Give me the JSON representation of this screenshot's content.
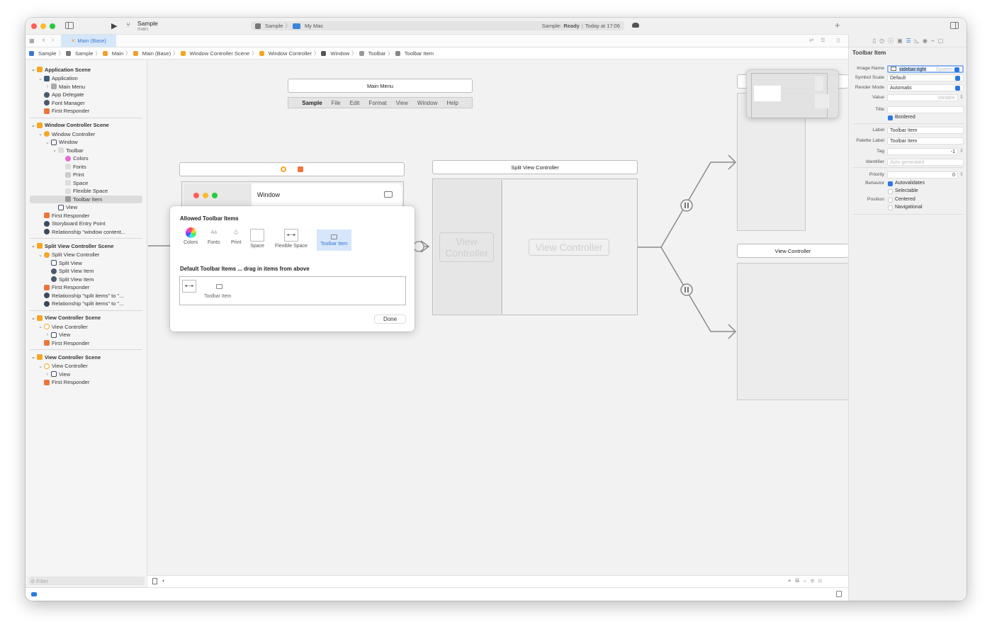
{
  "toolbar": {
    "scheme": "Sample",
    "branch": "main",
    "destination_project": "Sample",
    "destination": "My Mac",
    "status_prefix": "Sample: ",
    "status": "Ready",
    "status_time": "Today at 17:06",
    "add": "+"
  },
  "tab": {
    "label": "Main (Base)"
  },
  "breadcrumbs": [
    "Sample",
    "Sample",
    "Main",
    "Main (Base)",
    "Window Controller Scene",
    "Window Controller",
    "Window",
    "Toolbar",
    "Toolbar Item"
  ],
  "navigator": {
    "filter_placeholder": "Filter",
    "sections": [
      {
        "items": [
          {
            "label": "Application Scene",
            "level": 0,
            "header": true,
            "disc": "v",
            "icon": "scene-icon"
          },
          {
            "label": "Application",
            "level": 1,
            "disc": "v",
            "icon": "app-icon"
          },
          {
            "label": "Main Menu",
            "level": 2,
            "disc": ">",
            "icon": "menu-icon"
          },
          {
            "label": "App Delegate",
            "level": 1,
            "icon": "object-icon"
          },
          {
            "label": "Font Manager",
            "level": 1,
            "icon": "object-icon"
          },
          {
            "label": "First Responder",
            "level": 1,
            "icon": "first-responder-icon"
          }
        ]
      },
      {
        "items": [
          {
            "label": "Window Controller Scene",
            "level": 0,
            "header": true,
            "disc": "v",
            "icon": "scene-icon"
          },
          {
            "label": "Window Controller",
            "level": 1,
            "disc": "v",
            "icon": "window-controller-icon"
          },
          {
            "label": "Window",
            "level": 2,
            "disc": "v",
            "icon": "window-icon"
          },
          {
            "label": "Toolbar",
            "level": 3,
            "disc": "v",
            "icon": "toolbar-icon"
          },
          {
            "label": "Colors",
            "level": 4,
            "icon": "colors-icon"
          },
          {
            "label": "Fonts",
            "level": 4,
            "icon": "fonts-icon"
          },
          {
            "label": "Print",
            "level": 4,
            "icon": "print-icon"
          },
          {
            "label": "Space",
            "level": 4,
            "icon": "space-icon"
          },
          {
            "label": "Flexible Space",
            "level": 4,
            "icon": "flexible-space-icon"
          },
          {
            "label": "Toolbar Item",
            "level": 4,
            "icon": "gear-icon",
            "selected": true
          },
          {
            "label": "View",
            "level": 3,
            "icon": "view-icon"
          },
          {
            "label": "First Responder",
            "level": 1,
            "icon": "first-responder-icon"
          },
          {
            "label": "Storyboard Entry Point",
            "level": 1,
            "icon": "entry-point-icon"
          },
          {
            "label": "Relationship \"window content...",
            "level": 1,
            "icon": "relationship-icon"
          }
        ]
      },
      {
        "items": [
          {
            "label": "Split View Controller Scene",
            "level": 0,
            "header": true,
            "disc": "v",
            "icon": "scene-icon"
          },
          {
            "label": "Split View Controller",
            "level": 1,
            "disc": "v",
            "icon": "split-view-controller-icon"
          },
          {
            "label": "Split View",
            "level": 2,
            "icon": "split-view-icon"
          },
          {
            "label": "Split View Item",
            "level": 2,
            "icon": "object-icon"
          },
          {
            "label": "Split View Item",
            "level": 2,
            "icon": "object-icon"
          },
          {
            "label": "First Responder",
            "level": 1,
            "icon": "first-responder-icon"
          },
          {
            "label": "Relationship \"split items\" to \"...",
            "level": 1,
            "icon": "relationship-icon"
          },
          {
            "label": "Relationship \"split items\" to \"...",
            "level": 1,
            "icon": "relationship-icon"
          }
        ]
      },
      {
        "items": [
          {
            "label": "View Controller Scene",
            "level": 0,
            "header": true,
            "disc": "v",
            "icon": "scene-icon"
          },
          {
            "label": "View Controller",
            "level": 1,
            "disc": "v",
            "icon": "view-controller-icon"
          },
          {
            "label": "View",
            "level": 2,
            "disc": ">",
            "icon": "view-icon"
          },
          {
            "label": "First Responder",
            "level": 1,
            "icon": "first-responder-icon"
          }
        ]
      },
      {
        "items": [
          {
            "label": "View Controller Scene",
            "level": 0,
            "header": true,
            "disc": "v",
            "icon": "scene-icon"
          },
          {
            "label": "View Controller",
            "level": 1,
            "disc": "v",
            "icon": "view-controller-icon"
          },
          {
            "label": "View",
            "level": 2,
            "disc": ">",
            "icon": "view-icon"
          },
          {
            "label": "First Responder",
            "level": 1,
            "icon": "first-responder-icon"
          }
        ]
      }
    ]
  },
  "canvas": {
    "main_menu": {
      "title": "Main Menu",
      "items": [
        "Sample",
        "File",
        "Edit",
        "Format",
        "View",
        "Window",
        "Help"
      ]
    },
    "window": {
      "title": "Window"
    },
    "popover": {
      "allowed_title": "Allowed Toolbar Items",
      "allowed": [
        "Colors",
        "Fonts",
        "Print",
        "Space",
        "Flexible Space",
        "Toolbar Item"
      ],
      "default_title": "Default Toolbar Items ... drag in items from above",
      "default_item": "Toolbar Item",
      "done": "Done",
      "fonts_glyph": "Aa"
    },
    "split_view_controller": {
      "title": "Split View Controller",
      "left_placeholder": "View Controller",
      "right_placeholder": "View Controller"
    },
    "view_controller": {
      "title": "View Controller"
    }
  },
  "inspector": {
    "title": "Toolbar Item",
    "image_name_label": "Image Name",
    "image_name": "sidebar.right",
    "image_name_hint": "System",
    "symbol_scale_label": "Symbol Scale",
    "symbol_scale": "Default",
    "render_mode_label": "Render Mode",
    "render_mode": "Automatic",
    "value_label": "Value",
    "value_placeholder": "Variable",
    "title_label": "Title",
    "title_value": "",
    "bordered": "Bordered",
    "label_label": "Label",
    "label": "Toolbar Item",
    "palette_label_label": "Palette Label",
    "palette_label": "Toolbar Item",
    "tag_label": "Tag",
    "tag": "-1",
    "identifier_label": "Identifier",
    "identifier_placeholder": "Auto-generated",
    "priority_label": "Priority",
    "priority": "0",
    "behavior_label": "Behavior",
    "autovalidates": "Autovalidates",
    "selectable": "Selectable",
    "position_label": "Position",
    "centered": "Centered",
    "navigational": "Navigational",
    "checks": {
      "bordered": true,
      "autovalidates": true,
      "selectable": false,
      "centered": false,
      "navigational": false
    }
  },
  "colors": {
    "accent": "#2a7ae2",
    "scene_orange": "#f5a623",
    "first_responder": "#f0743a"
  }
}
